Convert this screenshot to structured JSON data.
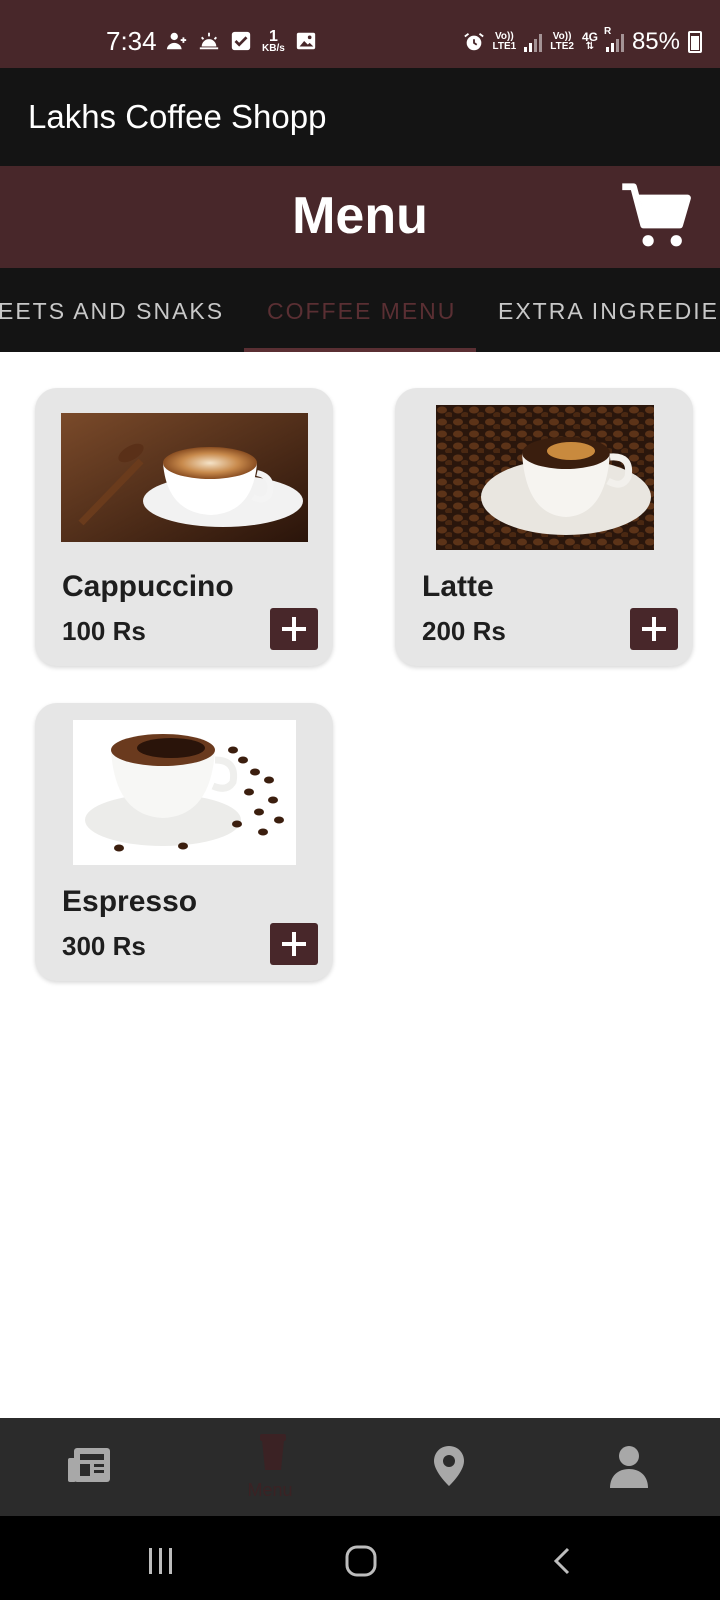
{
  "status_bar": {
    "time": "7:34",
    "net_speed_value": "1",
    "net_speed_unit": "KB/s",
    "sim1_label_top": "Vo))",
    "sim1_label_bottom": "LTE1",
    "sim2_label_top": "Vo))",
    "sim2_label_bottom": "LTE2",
    "network_type": "4G",
    "roaming": "R",
    "battery": "85%"
  },
  "app_bar": {
    "title": "Lakhs Coffee Shopp"
  },
  "header": {
    "title": "Menu",
    "cart_icon": "cart-icon"
  },
  "tabs": [
    {
      "label": "EETS AND SNAKS",
      "active": false
    },
    {
      "label": "COFFEE MENU",
      "active": true
    },
    {
      "label": "EXTRA INGREDIE",
      "active": false
    }
  ],
  "products": [
    {
      "name": "Cappuccino",
      "price": "100 Rs"
    },
    {
      "name": "Latte",
      "price": "200 Rs"
    },
    {
      "name": "Espresso",
      "price": "300 Rs"
    }
  ],
  "bottom_nav": [
    {
      "icon": "news-icon",
      "label": ""
    },
    {
      "icon": "coffee-cup-icon",
      "label": "Menu"
    },
    {
      "icon": "location-pin-icon",
      "label": ""
    },
    {
      "icon": "person-icon",
      "label": ""
    }
  ],
  "colors": {
    "brand": "#48272a",
    "app_bar": "#141414",
    "card": "#e6e6e6",
    "bottom_nav": "#2b2b2b"
  }
}
